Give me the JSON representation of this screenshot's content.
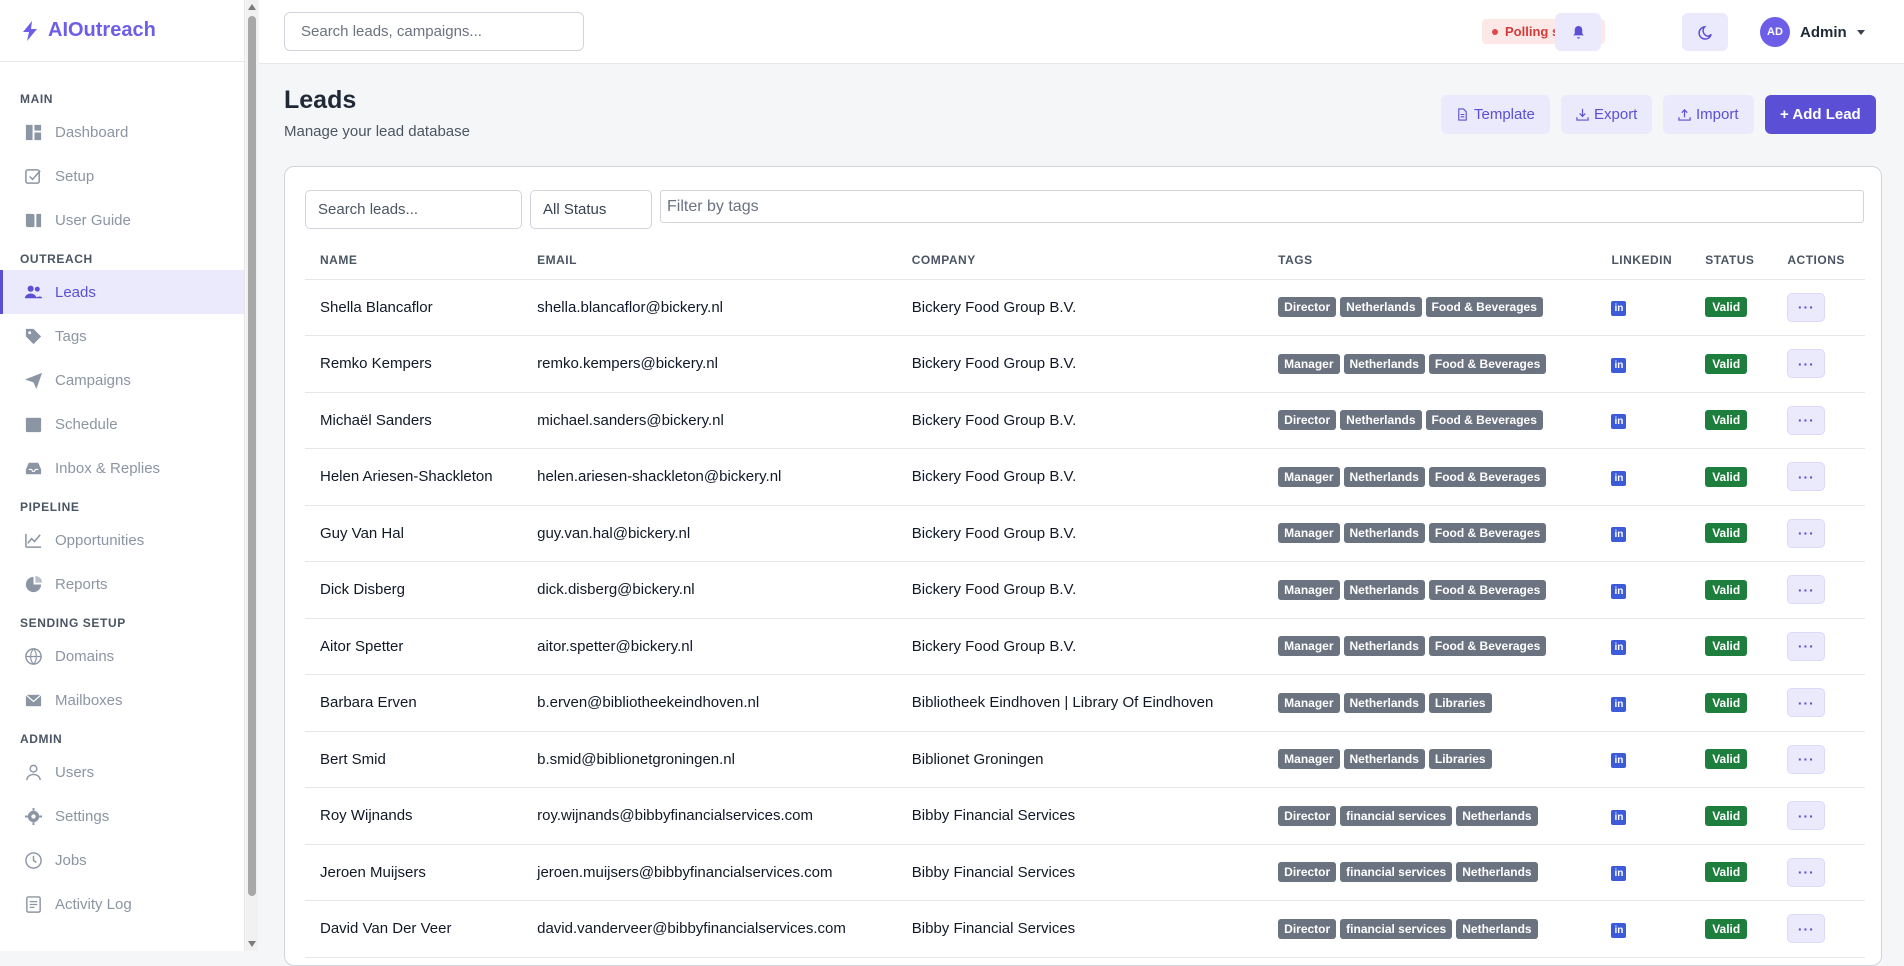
{
  "brand": {
    "name": "AIOutreach"
  },
  "sidebar": {
    "sections": [
      {
        "label": "MAIN",
        "items": [
          {
            "label": "Dashboard",
            "icon": "dashboard-icon"
          },
          {
            "label": "Setup",
            "icon": "checkbox-icon"
          },
          {
            "label": "User Guide",
            "icon": "book-icon"
          }
        ]
      },
      {
        "label": "OUTREACH",
        "items": [
          {
            "label": "Leads",
            "icon": "users-icon",
            "active": true
          },
          {
            "label": "Tags",
            "icon": "tag-icon"
          },
          {
            "label": "Campaigns",
            "icon": "send-icon"
          },
          {
            "label": "Schedule",
            "icon": "calendar-icon"
          },
          {
            "label": "Inbox & Replies",
            "icon": "inbox-icon"
          }
        ]
      },
      {
        "label": "PIPELINE",
        "items": [
          {
            "label": "Opportunities",
            "icon": "chart-line-icon"
          },
          {
            "label": "Reports",
            "icon": "pie-chart-icon"
          }
        ]
      },
      {
        "label": "SENDING SETUP",
        "items": [
          {
            "label": "Domains",
            "icon": "globe-icon"
          },
          {
            "label": "Mailboxes",
            "icon": "envelope-icon"
          }
        ]
      },
      {
        "label": "ADMIN",
        "items": [
          {
            "label": "Users",
            "icon": "user-icon"
          },
          {
            "label": "Settings",
            "icon": "gear-icon"
          },
          {
            "label": "Jobs",
            "icon": "clock-icon"
          },
          {
            "label": "Activity Log",
            "icon": "log-icon"
          }
        ]
      }
    ]
  },
  "topbar": {
    "search_placeholder": "Search leads, campaigns...",
    "polling": "Polling started",
    "user_initials": "AD",
    "user_name": "Admin"
  },
  "page": {
    "title": "Leads",
    "subtitle": "Manage your lead database",
    "buttons": {
      "template": "Template",
      "export": "Export",
      "import": "Import",
      "add": "+ Add Lead"
    }
  },
  "filters": {
    "search_placeholder": "Search leads...",
    "status": "All Status",
    "tags_placeholder": "Filter by tags"
  },
  "table": {
    "columns": [
      "NAME",
      "EMAIL",
      "COMPANY",
      "TAGS",
      "LINKEDIN",
      "STATUS",
      "ACTIONS"
    ],
    "rows": [
      {
        "name": "Shella Blancaflor",
        "email": "shella.blancaflor@bickery.nl",
        "company": "Bickery Food Group B.V.",
        "tags": [
          "Director",
          "Netherlands",
          "Food & Beverages"
        ],
        "status": "Valid"
      },
      {
        "name": "Remko Kempers",
        "email": "remko.kempers@bickery.nl",
        "company": "Bickery Food Group B.V.",
        "tags": [
          "Manager",
          "Netherlands",
          "Food & Beverages"
        ],
        "status": "Valid"
      },
      {
        "name": "Michaël Sanders",
        "email": "michael.sanders@bickery.nl",
        "company": "Bickery Food Group B.V.",
        "tags": [
          "Director",
          "Netherlands",
          "Food & Beverages"
        ],
        "status": "Valid"
      },
      {
        "name": "Helen Ariesen-Shackleton",
        "email": "helen.ariesen-shackleton@bickery.nl",
        "company": "Bickery Food Group B.V.",
        "tags": [
          "Manager",
          "Netherlands",
          "Food & Beverages"
        ],
        "status": "Valid"
      },
      {
        "name": "Guy Van Hal",
        "email": "guy.van.hal@bickery.nl",
        "company": "Bickery Food Group B.V.",
        "tags": [
          "Manager",
          "Netherlands",
          "Food & Beverages"
        ],
        "status": "Valid"
      },
      {
        "name": "Dick Disberg",
        "email": "dick.disberg@bickery.nl",
        "company": "Bickery Food Group B.V.",
        "tags": [
          "Manager",
          "Netherlands",
          "Food & Beverages"
        ],
        "status": "Valid"
      },
      {
        "name": "Aitor Spetter",
        "email": "aitor.spetter@bickery.nl",
        "company": "Bickery Food Group B.V.",
        "tags": [
          "Manager",
          "Netherlands",
          "Food & Beverages"
        ],
        "status": "Valid"
      },
      {
        "name": "Barbara Erven",
        "email": "b.erven@bibliotheekeindhoven.nl",
        "company": "Bibliotheek Eindhoven | Library Of Eindhoven",
        "tags": [
          "Manager",
          "Netherlands",
          "Libraries"
        ],
        "status": "Valid"
      },
      {
        "name": "Bert Smid",
        "email": "b.smid@biblionetgroningen.nl",
        "company": "Biblionet Groningen",
        "tags": [
          "Manager",
          "Netherlands",
          "Libraries"
        ],
        "status": "Valid"
      },
      {
        "name": "Roy Wijnands",
        "email": "roy.wijnands@bibbyfinancialservices.com",
        "company": "Bibby Financial Services",
        "tags": [
          "Director",
          "financial services",
          "Netherlands"
        ],
        "status": "Valid"
      },
      {
        "name": "Jeroen Muijsers",
        "email": "jeroen.muijsers@bibbyfinancialservices.com",
        "company": "Bibby Financial Services",
        "tags": [
          "Director",
          "financial services",
          "Netherlands"
        ],
        "status": "Valid"
      },
      {
        "name": "David Van Der Veer",
        "email": "david.vanderveer@bibbyfinancialservices.com",
        "company": "Bibby Financial Services",
        "tags": [
          "Director",
          "financial services",
          "Netherlands"
        ],
        "status": "Valid"
      }
    ]
  },
  "colors": {
    "accent": "#5b4fd6",
    "accent_light": "#ebe9fc",
    "valid": "#1e7e3e",
    "tag": "#6b7280",
    "linkedin": "#3b5bd8"
  }
}
